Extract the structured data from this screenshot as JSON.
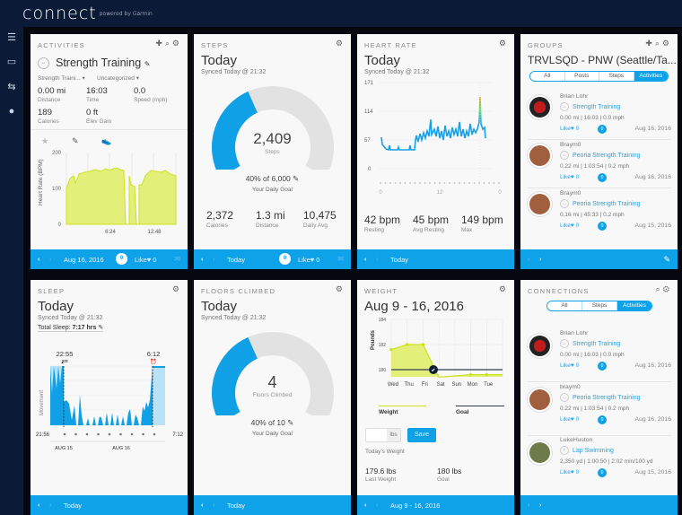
{
  "app": {
    "logo": "connect",
    "logo_sub": "powered by Garmin"
  },
  "sidebar": {
    "icons": [
      "menu-icon",
      "inbox-icon",
      "connections-icon",
      "profile-icon"
    ]
  },
  "activities": {
    "header": "ACTIVITIES",
    "title": "Strength Training",
    "type": "Strength Traini...",
    "category": "Uncategorized",
    "stats": [
      {
        "v": "0.00 mi",
        "l": "Distance"
      },
      {
        "v": "16:03",
        "l": "Time"
      },
      {
        "v": "0.0",
        "l": "Speed (mph)"
      },
      {
        "v": "189",
        "l": "Calories"
      },
      {
        "v": "0 ft",
        "l": "Elev Gain"
      }
    ],
    "chart": {
      "ylabel": "Heart Rate (BPM)",
      "yticks": [
        "200",
        "100",
        "0"
      ],
      "xticks": [
        "6:24",
        "12:48"
      ]
    },
    "footer": {
      "label": "Aug 16, 2016",
      "comments": "0",
      "like": "Like♥ 0"
    }
  },
  "steps": {
    "header": "STEPS",
    "title": "Today",
    "synced": "Synced Today @ 21:32",
    "value": "2,409",
    "unit": "Steps",
    "progress": 0.4,
    "goal": "40% of 6,000",
    "goal_label": "Your Daily Goal",
    "stats": [
      {
        "v": "2,372",
        "l": "Calories"
      },
      {
        "v": "1.3 mi",
        "l": "Distance"
      },
      {
        "v": "10,475",
        "l": "Daily Avg"
      }
    ],
    "footer": {
      "label": "Today",
      "comments": "0",
      "like": "Like♥ 0"
    }
  },
  "heart": {
    "header": "HEART RATE",
    "title": "Today",
    "synced": "Synced Today @ 21:32",
    "yticks": [
      "171",
      "114",
      "57",
      "0"
    ],
    "xticks": [
      "0",
      "12",
      "0"
    ],
    "stats": [
      {
        "v": "42 bpm",
        "l": "Resting"
      },
      {
        "v": "45 bpm",
        "l": "Avg Resting"
      },
      {
        "v": "149 bpm",
        "l": "Max"
      }
    ],
    "footer": {
      "label": "Today"
    }
  },
  "groups": {
    "header": "GROUPS",
    "title": "TRVLSQD - PNW (Seattle/Ta...",
    "tabs": [
      "All",
      "Posts",
      "Steps",
      "Activities"
    ],
    "items": [
      {
        "name": "Brian Lohr",
        "activity": "Strength Training",
        "stats": "0.00 mi | 16:03 | 0.0 mph",
        "like": "Like♥ 0",
        "comments": "0",
        "date": "Aug 16, 2016"
      },
      {
        "name": "Braym0",
        "activity": "Peoria Strength Training",
        "stats": "0.22 mi | 1:03:54 | 0.2 mph",
        "like": "Like♥ 0",
        "comments": "0",
        "date": "Aug 16, 2016"
      },
      {
        "name": "Braym0",
        "activity": "Peoria Strength Training",
        "stats": "0.16 mi | 45:33 | 0.2 mph",
        "like": "Like♥ 0",
        "comments": "0",
        "date": "Aug 15, 2016"
      }
    ]
  },
  "sleep": {
    "header": "SLEEP",
    "title": "Today",
    "synced": "Synced Today @ 21:32",
    "total_label": "Total Sleep:",
    "total": "7:17 hrs",
    "start": "22:55",
    "end": "6:12",
    "ylabel": "Movement",
    "x_start": "21:56",
    "x_end": "7:12",
    "days": [
      "AUG 15",
      "AUG 16"
    ],
    "footer": {
      "label": "Today"
    }
  },
  "floors": {
    "header": "FLOORS CLIMBED",
    "title": "Today",
    "synced": "Synced Today @ 21:32",
    "value": "4",
    "unit": "Floors Climbed",
    "progress": 0.4,
    "goal": "40% of 10",
    "goal_label": "Your Daily Goal",
    "footer": {
      "label": "Today"
    }
  },
  "weight": {
    "header": "WEIGHT",
    "title": "Aug 9 - 16, 2016",
    "ylabel": "Pounds",
    "yticks": [
      "184",
      "182",
      "180"
    ],
    "days": [
      "Wed",
      "Thu",
      "Fri",
      "Sat",
      "Sun",
      "Mon",
      "Tue"
    ],
    "values": [
      181.6,
      182,
      182,
      179.4,
      179.5,
      179.6,
      179.6
    ],
    "goal_value": 180,
    "legend": [
      "Weight",
      "Goal"
    ],
    "unit": "lbs",
    "save": "Save",
    "input_label": "Today's Weight",
    "stats": [
      {
        "v": "179.6 lbs",
        "l": "Last Weight"
      },
      {
        "v": "180 lbs",
        "l": "Goal"
      }
    ],
    "footer": {
      "label": "Aug 9 - 16, 2016"
    }
  },
  "connections": {
    "header": "CONNECTIONS",
    "tabs": [
      "All",
      "Steps",
      "Activities"
    ],
    "items": [
      {
        "name": "Brian Lohr",
        "activity": "Strength Training",
        "stats": "0.00 mi | 16:03 | 0.0 mph",
        "like": "Like♥ 0",
        "comments": "0",
        "date": "Aug 16, 2016"
      },
      {
        "name": "braym0",
        "activity": "Peoria Strength Training",
        "stats": "0.22 mi | 1:03:54 | 0.2 mph",
        "like": "Like♥ 0",
        "comments": "0",
        "date": "Aug 16, 2016"
      },
      {
        "name": "LukeHuston",
        "activity": "Lap Swimming",
        "stats": "2,350 yd | 1:00:50 | 2:02 min/100 yd",
        "like": "Like♥ 0",
        "comments": "0",
        "date": "Aug 15, 2016"
      }
    ]
  }
}
